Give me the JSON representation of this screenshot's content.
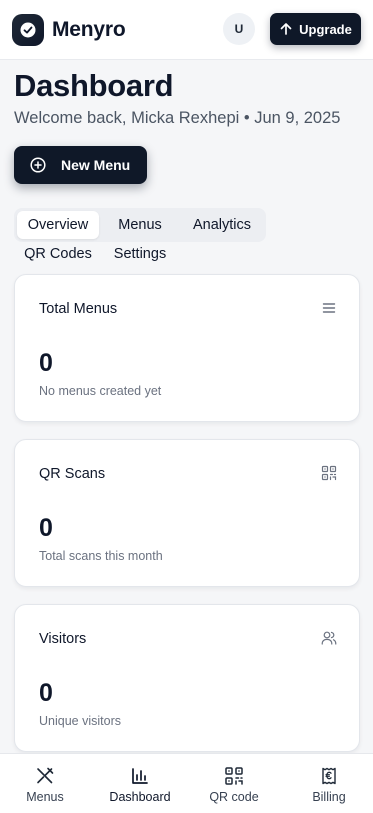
{
  "header": {
    "brand": "Menyro",
    "avatar_initial": "U",
    "upgrade_label": "Upgrade"
  },
  "page": {
    "title": "Dashboard",
    "welcome": "Welcome back, Micka Rexhepi • Jun 9, 2025",
    "new_menu_label": "New Menu"
  },
  "tabs": {
    "active": "Overview",
    "items": [
      {
        "label": "Overview"
      },
      {
        "label": "Menus"
      },
      {
        "label": "Analytics"
      },
      {
        "label": "QR Codes"
      },
      {
        "label": "Settings"
      }
    ]
  },
  "cards": [
    {
      "title": "Total Menus",
      "value": "0",
      "description": "No menus created yet",
      "icon": "list-icon"
    },
    {
      "title": "QR Scans",
      "value": "0",
      "description": "Total scans this month",
      "icon": "qr-code-icon"
    },
    {
      "title": "Visitors",
      "value": "0",
      "description": "Unique visitors",
      "icon": "users-icon"
    }
  ],
  "bottom_nav": {
    "active": "Dashboard",
    "items": [
      {
        "label": "Menus",
        "icon": "utensils-crossed-icon"
      },
      {
        "label": "Dashboard",
        "icon": "bar-chart-icon"
      },
      {
        "label": "QR code",
        "icon": "qr-code-icon"
      },
      {
        "label": "Billing",
        "icon": "receipt-euro-icon"
      }
    ]
  },
  "colors": {
    "primary": "#0f1828",
    "background": "#f5f6f8",
    "card": "#ffffff",
    "muted_text": "#6b7280"
  }
}
